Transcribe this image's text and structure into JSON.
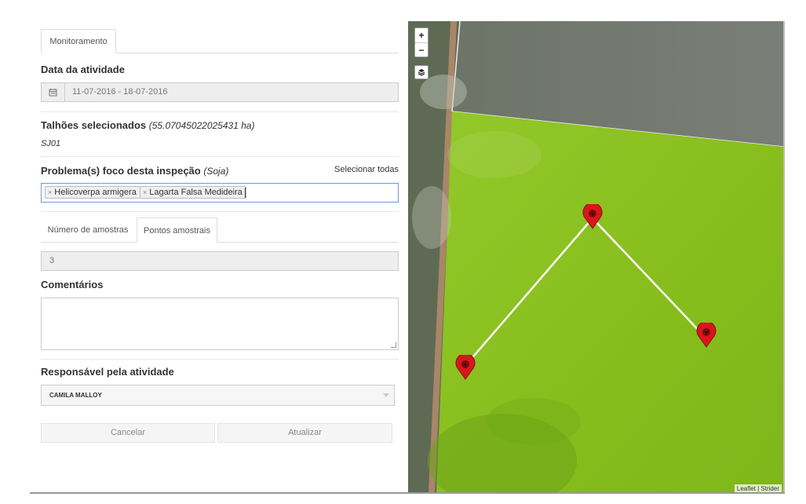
{
  "form": {
    "tab_label": "Monitoramento",
    "date_label": "Data da atividade",
    "date_icon": "calendar-icon",
    "date_value": "11-07-2016 - 18-07-2016",
    "plots_label": "Talhões selecionados",
    "plots_area": "(55.07045022025431 ha)",
    "plot_name": "SJ01",
    "problems_label": "Problema(s) foco desta inspeção",
    "problems_crop": "(Soja)",
    "select_all": "Selecionar todas",
    "tags": [
      "Helicoverpa armigera",
      "Lagarta Falsa Medideira"
    ],
    "tag_remove": "×",
    "subtabs": [
      "Número de amostras",
      "Pontos amostrais"
    ],
    "active_subtab": "Pontos amostrais",
    "samples_value": "3",
    "comments_label": "Comentários",
    "comments_value": "",
    "responsible_label": "Responsável pela atividade",
    "responsible_value": "CAMILA MALLOY",
    "cancel_label": "Cancelar",
    "update_label": "Atualizar"
  },
  "map": {
    "zoom_in": "+",
    "zoom_out": "−",
    "layers_icon": "layers-icon",
    "marker_icon": "map-pin-icon",
    "attribution": "Leaflet | Strider",
    "field_color": "#8cc21e",
    "marker_color": "#d9161b",
    "sample_point_count": 3
  }
}
